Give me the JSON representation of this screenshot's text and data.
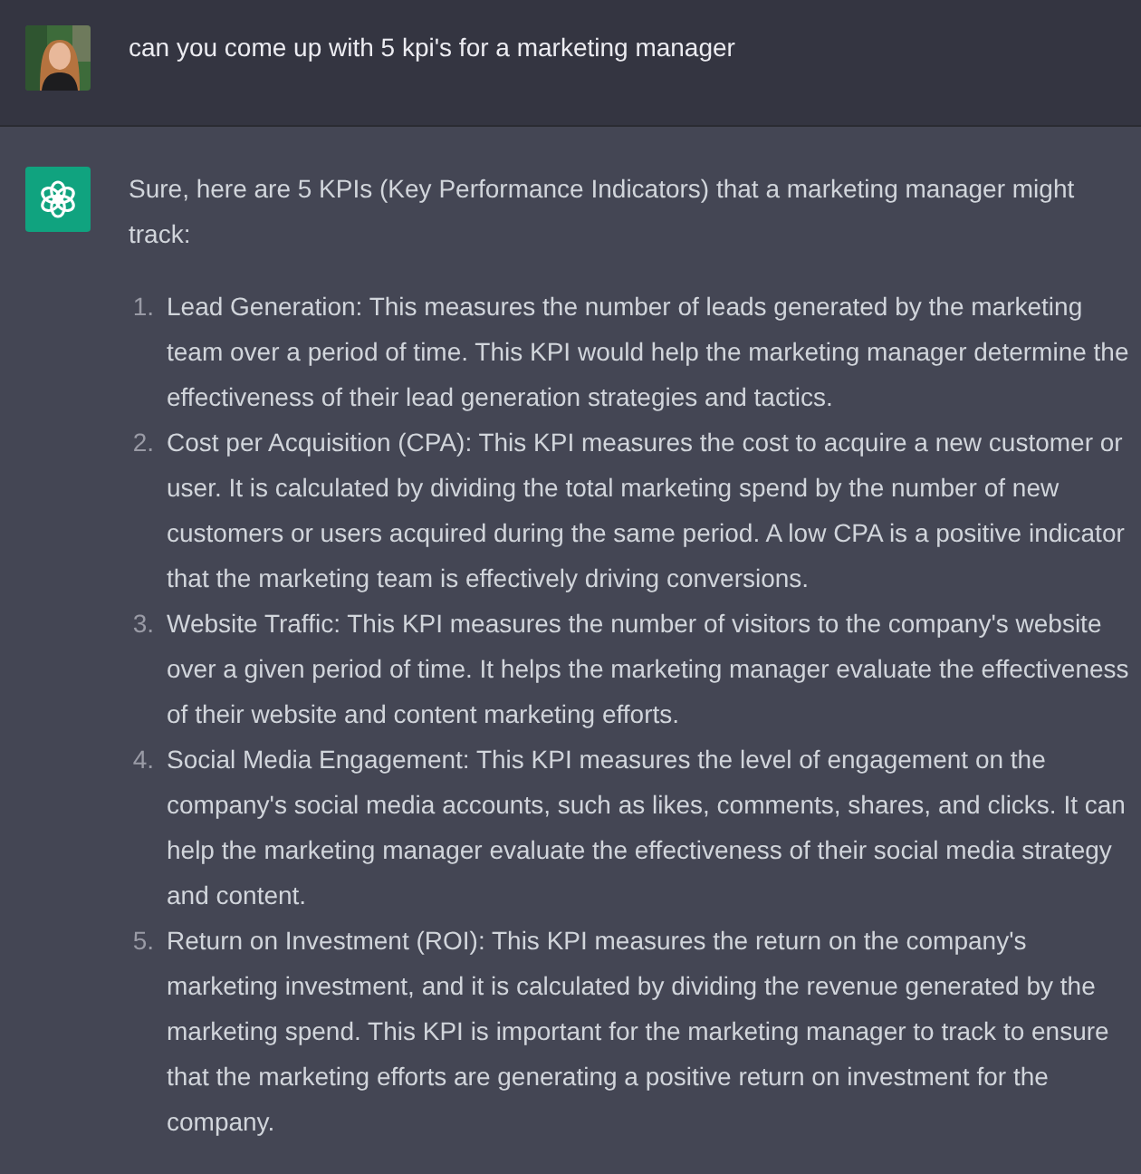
{
  "user_message": {
    "text": "can you come up with 5 kpi's for a marketing manager"
  },
  "assistant_message": {
    "intro": "Sure, here are 5 KPIs (Key Performance Indicators) that a marketing manager might track:",
    "items": [
      {
        "number": "1.",
        "text": "Lead Generation: This measures the number of leads generated by the marketing team over a period of time. This KPI would help the marketing manager determine the effectiveness of their lead generation strategies and tactics."
      },
      {
        "number": "2.",
        "text": "Cost per Acquisition (CPA): This KPI measures the cost to acquire a new customer or user. It is calculated by dividing the total marketing spend by the number of new customers or users acquired during the same period. A low CPA is a positive indicator that the marketing team is effectively driving conversions."
      },
      {
        "number": "3.",
        "text": "Website Traffic: This KPI measures the number of visitors to the company's website over a given period of time. It helps the marketing manager evaluate the effectiveness of their website and content marketing efforts."
      },
      {
        "number": "4.",
        "text": "Social Media Engagement: This KPI measures the level of engagement on the company's social media accounts, such as likes, comments, shares, and clicks. It can help the marketing manager evaluate the effectiveness of their social media strategy and content."
      },
      {
        "number": "5.",
        "text": "Return on Investment (ROI): This KPI measures the return on the company's marketing investment, and it is calculated by dividing the revenue generated by the marketing spend. This KPI is important for the marketing manager to track to ensure that the marketing efforts are generating a positive return on investment for the company."
      }
    ]
  }
}
